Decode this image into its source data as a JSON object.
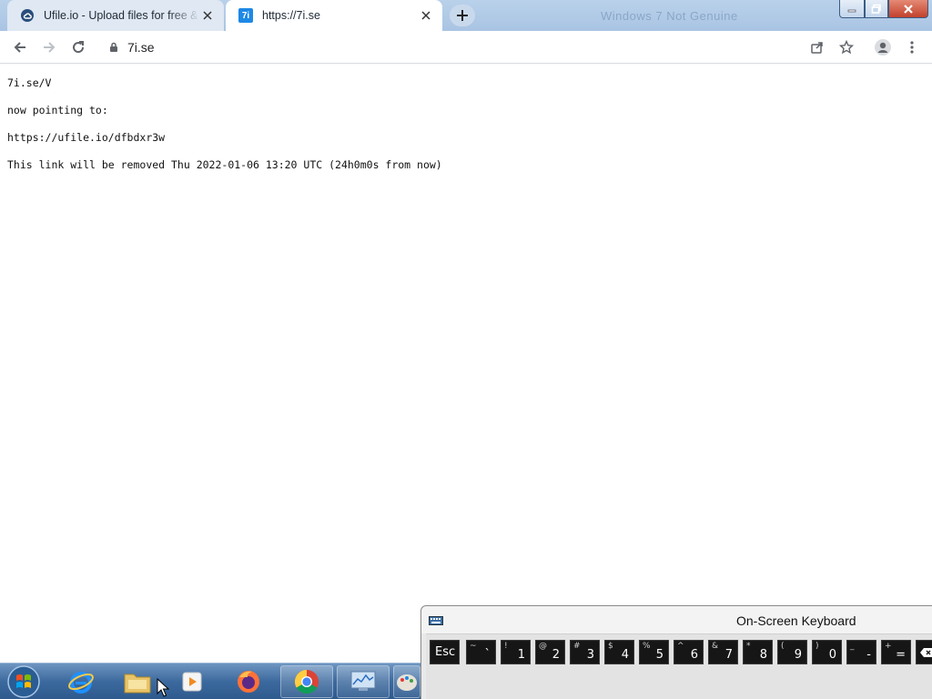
{
  "browser": {
    "tabs": [
      {
        "title": "Ufile.io - Upload files for free & s",
        "favicon": "ufile-logo-icon",
        "active": false
      },
      {
        "title": "https://7i.se",
        "favicon": "7i-logo-icon",
        "favicon_text": "7i",
        "active": true
      }
    ],
    "faded_window_text": "Windows 7 Not Genuine",
    "address": "7i.se"
  },
  "page": {
    "line1": "7i.se/V",
    "line2": "now pointing to:",
    "line3": "https://ufile.io/dfbdxr3w",
    "line4": "This link will be removed Thu 2022-01-06 13:20 UTC (24h0m0s from now)"
  },
  "taskbar": {
    "items": [
      "start-orb",
      "internet-explorer",
      "file-explorer",
      "media-player",
      "firefox",
      "chrome",
      "resource-monitor",
      "paint"
    ]
  },
  "osk": {
    "title": "On-Screen Keyboard",
    "keys": [
      {
        "main": "Esc",
        "shift": ""
      },
      {
        "main": "`",
        "shift": "~"
      },
      {
        "main": "1",
        "shift": "!"
      },
      {
        "main": "2",
        "shift": "@"
      },
      {
        "main": "3",
        "shift": "#"
      },
      {
        "main": "4",
        "shift": "$"
      },
      {
        "main": "5",
        "shift": "%"
      },
      {
        "main": "6",
        "shift": "^"
      },
      {
        "main": "7",
        "shift": "&"
      },
      {
        "main": "8",
        "shift": "*"
      },
      {
        "main": "9",
        "shift": "("
      },
      {
        "main": "0",
        "shift": ")"
      },
      {
        "main": "-",
        "shift": "_"
      },
      {
        "main": "=",
        "shift": "+"
      }
    ]
  },
  "colors": {
    "accent": "#1a73e8",
    "taskbar": "#3d6a9e",
    "osk_key": "#161616"
  }
}
